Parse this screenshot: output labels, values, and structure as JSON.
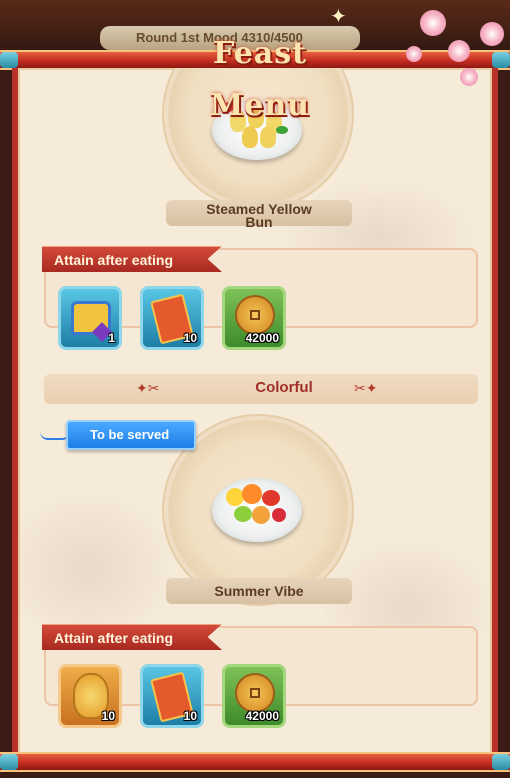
{
  "header": {
    "round_text": "Round 1st Mood 4310/4500",
    "title": "Feast Menu"
  },
  "dish_1": {
    "name_line1": "Steamed Yellow",
    "name_line2": "Bun",
    "reward_tag": "Attain after eating",
    "rewards": [
      {
        "icon": "treasure-chest-icon",
        "qty": "1",
        "color": "blue"
      },
      {
        "icon": "red-envelope-icon",
        "qty": "10",
        "color": "blue"
      },
      {
        "icon": "gold-coin-icon",
        "qty": "42000",
        "color": "green"
      }
    ]
  },
  "dish_2": {
    "category": "Colorful",
    "status": "To be served",
    "name": "Summer Vibe",
    "reward_tag": "Attain after eating",
    "rewards": [
      {
        "icon": "upgrade-stone-icon",
        "qty": "10",
        "color": "orange"
      },
      {
        "icon": "red-envelope-icon",
        "qty": "10",
        "color": "blue"
      },
      {
        "icon": "gold-coin-icon",
        "qty": "42000",
        "color": "green"
      }
    ]
  },
  "colors": {
    "accent_red": "#c22c20",
    "parchment": "#f6ead8",
    "status_blue": "#1d7fe8"
  }
}
